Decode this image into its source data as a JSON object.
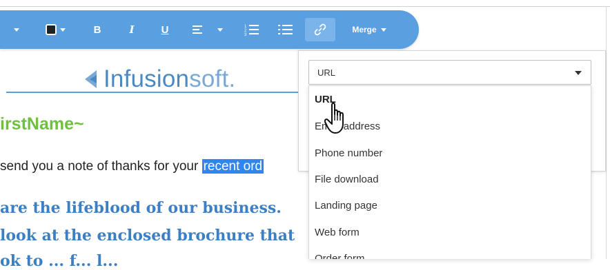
{
  "toolbar": {
    "merge_label": "Merge",
    "bold_label": "B",
    "italic_label": "I",
    "underline_label": "U",
    "color": "#5a9fdf",
    "active_color": "#7ab4ea",
    "icons": [
      "chevron-down-icon",
      "text-color-icon",
      "bold-icon",
      "italic-icon",
      "underline-icon",
      "align-left-icon",
      "numbered-list-icon",
      "bullet-list-icon",
      "link-icon"
    ]
  },
  "email": {
    "logo_text_bold": "Infusion",
    "logo_text_light": "soft",
    "logo_text_dot": ".",
    "merge_field": "irstName~",
    "body_text": "send you a note of thanks for your ",
    "body_selected": "recent ord",
    "line1": "are the lifeblood of our business.",
    "line2": "look at the enclosed brochure that",
    "line3": "ok to ... f... l...",
    "accent_green": "#6fc040",
    "accent_blue": "#3d7fc3"
  },
  "link_panel": {
    "selected_value": "URL",
    "options": [
      "URL",
      "Email address",
      "Phone number",
      "File download",
      "Landing page",
      "Web form",
      "Order form"
    ]
  }
}
